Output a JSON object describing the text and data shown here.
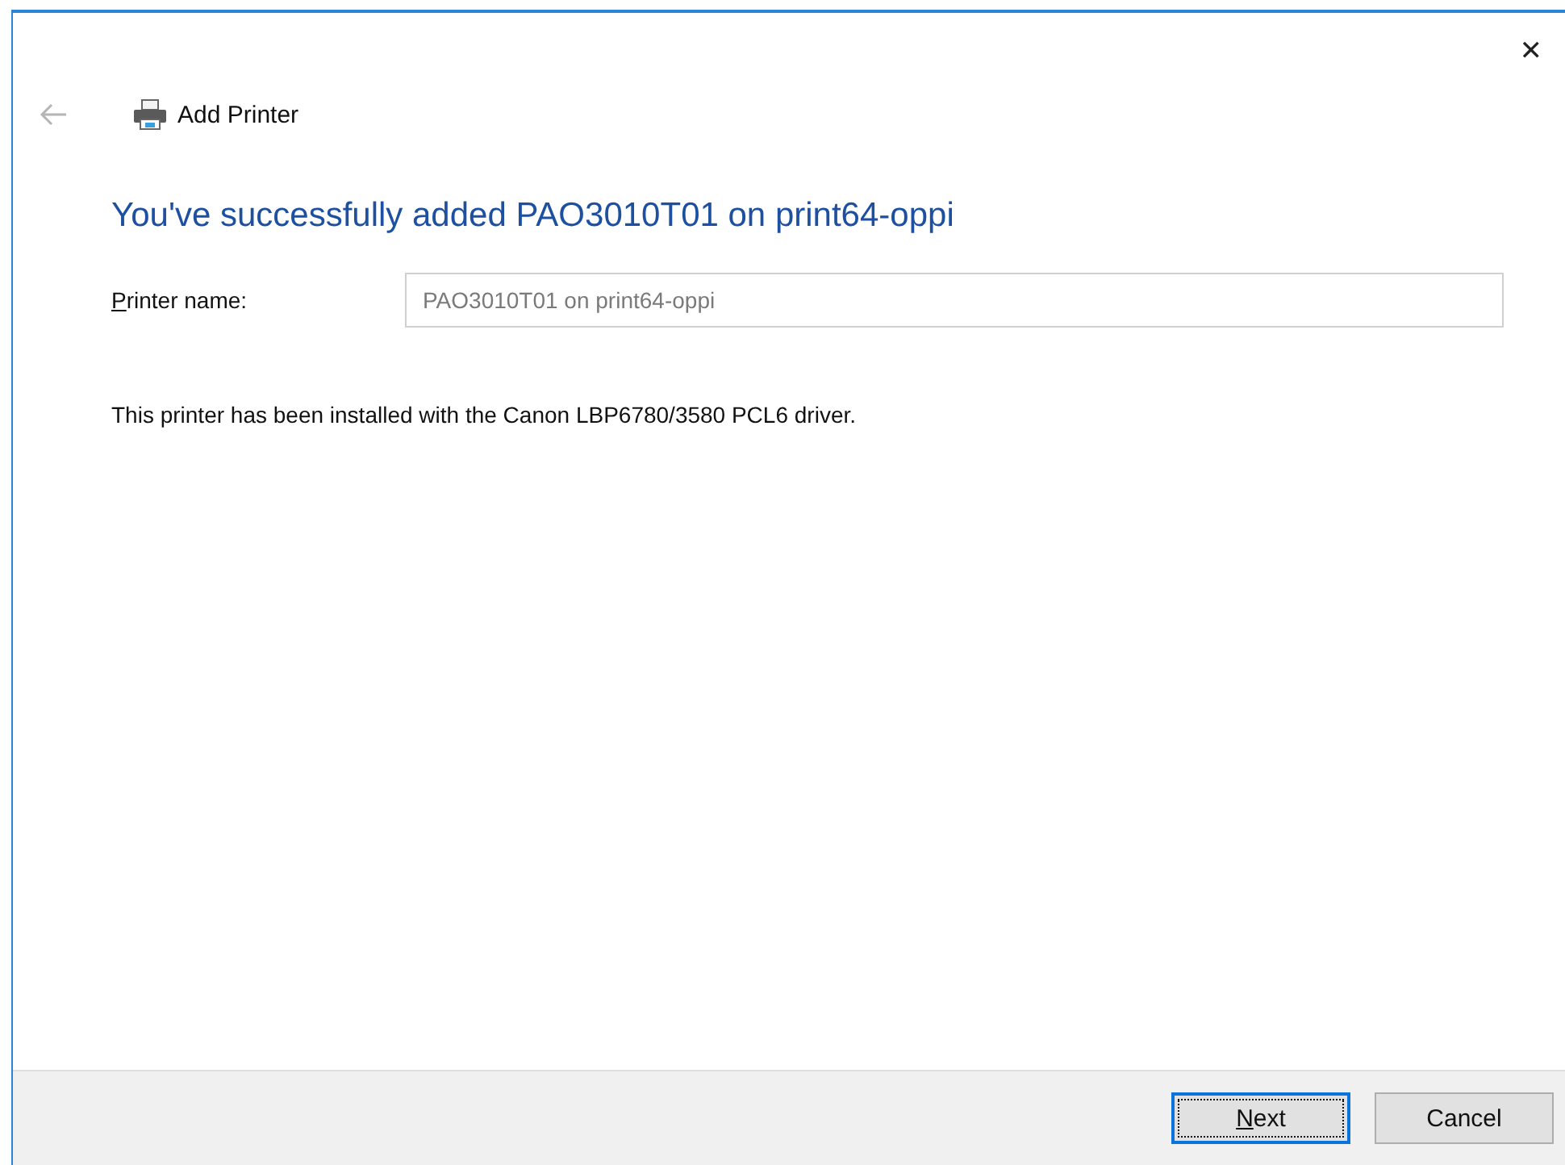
{
  "window": {
    "close_button": "✕",
    "back_enabled": false,
    "title": "Add Printer"
  },
  "heading": "You've successfully added PAO3010T01 on print64-oppi",
  "printer_name": {
    "label": "Printer name:",
    "access_key_underlined": true,
    "value": "PAO3010T01 on print64-oppi",
    "disabled": true
  },
  "message": "This printer has been installed with the Canon LBP6780/3580 PCL6 driver.",
  "buttons": [
    {
      "label": "Next",
      "default": true,
      "access_key_underlined": true
    },
    {
      "label": "Cancel",
      "default": false,
      "access_key_underlined": false
    }
  ]
}
